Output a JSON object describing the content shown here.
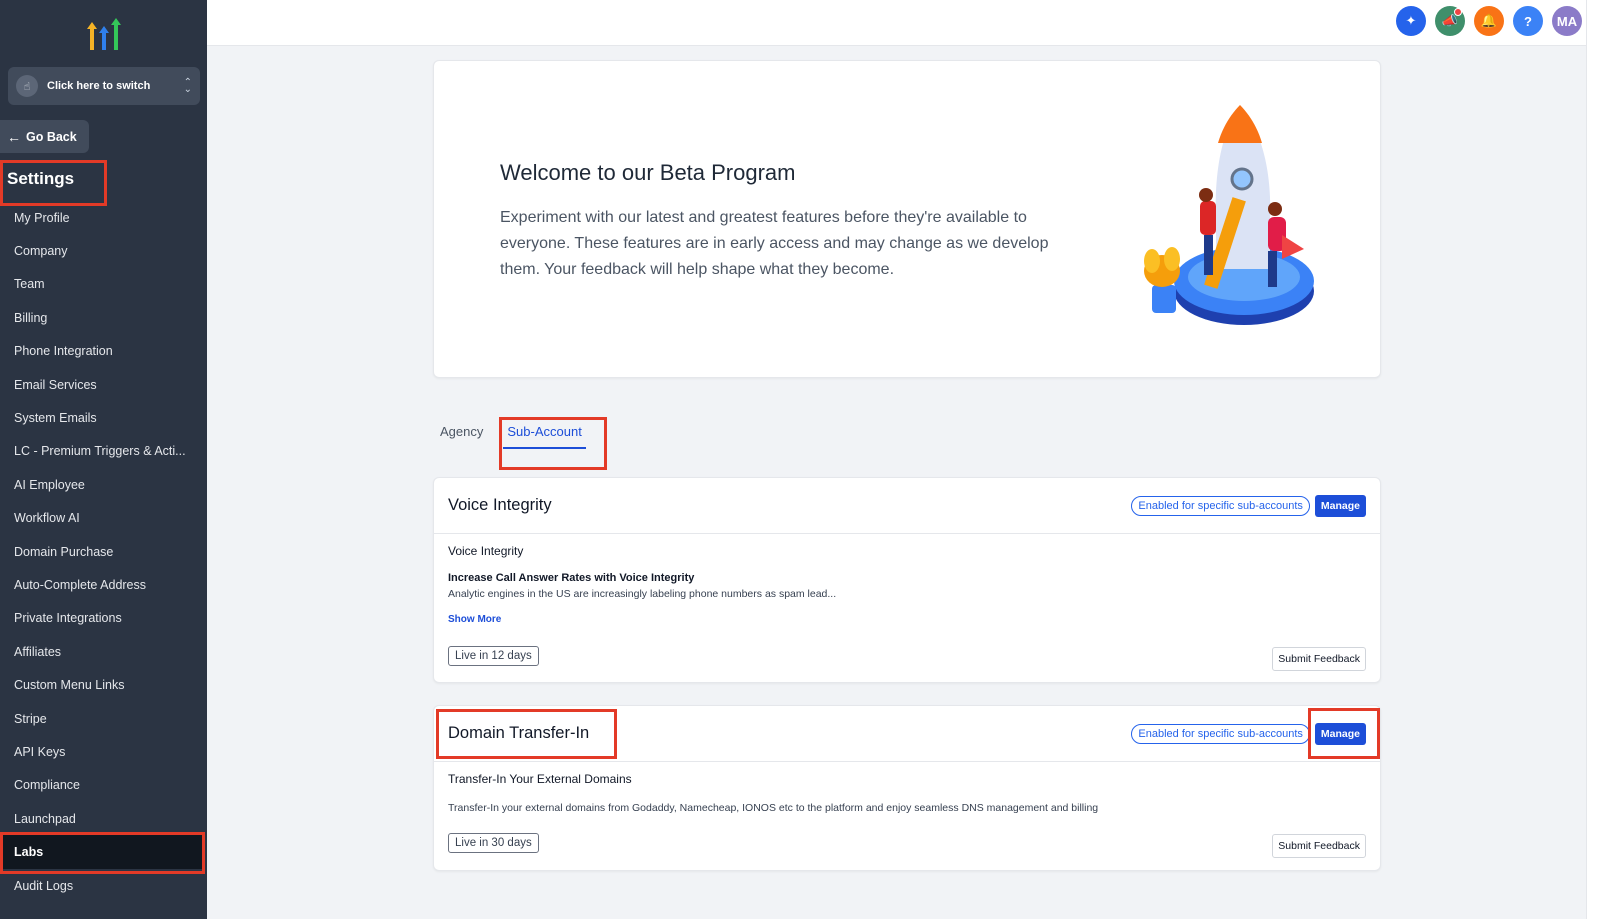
{
  "sidebar": {
    "switcher_label": "Click here to switch",
    "go_back": "Go Back",
    "settings_title": "Settings",
    "items": [
      {
        "label": "My Profile"
      },
      {
        "label": "Company"
      },
      {
        "label": "Team"
      },
      {
        "label": "Billing"
      },
      {
        "label": "Phone Integration"
      },
      {
        "label": "Email Services"
      },
      {
        "label": "System Emails"
      },
      {
        "label": "LC - Premium Triggers & Acti..."
      },
      {
        "label": "AI Employee"
      },
      {
        "label": "Workflow AI"
      },
      {
        "label": "Domain Purchase"
      },
      {
        "label": "Auto-Complete Address"
      },
      {
        "label": "Private Integrations"
      },
      {
        "label": "Affiliates"
      },
      {
        "label": "Custom Menu Links"
      },
      {
        "label": "Stripe"
      },
      {
        "label": "API Keys"
      },
      {
        "label": "Compliance"
      },
      {
        "label": "Launchpad"
      },
      {
        "label": "Labs",
        "active": true
      },
      {
        "label": "Audit Logs"
      }
    ]
  },
  "topbar": {
    "icons": [
      {
        "name": "magic-icon",
        "color": "#2563eb",
        "glyph": "✦"
      },
      {
        "name": "megaphone-icon",
        "color": "#3f8f6b",
        "glyph": "📣"
      },
      {
        "name": "bell-icon",
        "color": "#f97316",
        "glyph": "🔔"
      },
      {
        "name": "help-icon",
        "color": "#3b82f6",
        "glyph": "?"
      },
      {
        "name": "avatar",
        "color": "#8b7bc8",
        "glyph": "MA"
      }
    ]
  },
  "welcome": {
    "title": "Welcome to our Beta Program",
    "body": "Experiment with our latest and greatest features before they're available to everyone. These features are in early access and may change as we develop them. Your feedback will help shape what they become."
  },
  "tabs": [
    {
      "label": "Agency",
      "active": false
    },
    {
      "label": "Sub-Account",
      "active": true
    }
  ],
  "features": [
    {
      "title": "Voice Integrity",
      "badge": "Enabled for specific sub-accounts",
      "manage": "Manage",
      "subtitle": "Voice Integrity",
      "headline": "Increase Call Answer Rates with Voice Integrity",
      "description": "Analytic engines in the US are increasingly labeling phone numbers as spam lead...",
      "show_more": "Show More",
      "live": "Live in 12 days",
      "feedback": "Submit Feedback"
    },
    {
      "title": "Domain Transfer-In",
      "badge": "Enabled for specific sub-accounts",
      "manage": "Manage",
      "subtitle": "Transfer-In Your External Domains",
      "description": "Transfer-In your external domains from Godaddy, Namecheap, IONOS etc to the platform and enjoy seamless DNS management and billing",
      "live": "Live in 30 days",
      "feedback": "Submit Feedback"
    }
  ],
  "colors": {
    "sidebar_bg": "#2b3443",
    "accent": "#1d4ed8",
    "annotation": "#e33a27"
  }
}
